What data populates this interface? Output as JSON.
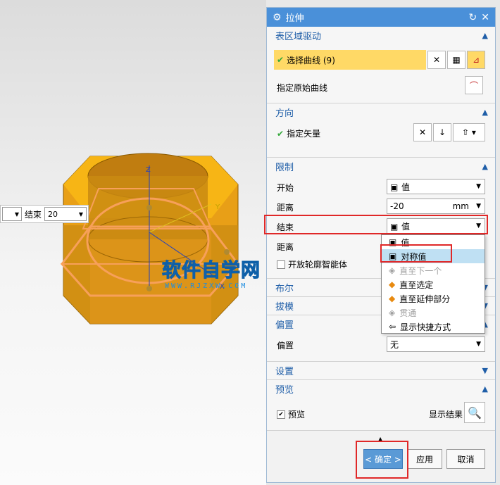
{
  "toolbar": {
    "end_label": "结束",
    "end_value": "20"
  },
  "watermark": {
    "main": "软件自学网",
    "sub": "WWW.RJZXW.COM"
  },
  "dialog": {
    "title": "拉伸",
    "sections": {
      "section_drive": {
        "header": "表区域驱动",
        "select_curve": "选择曲线 (9)",
        "specify_original": "指定原始曲线"
      },
      "section_direction": {
        "header": "方向",
        "specify_vector": "指定矢量"
      },
      "section_limits": {
        "header": "限制",
        "start_label": "开始",
        "start_value": "值",
        "distance_label": "距离",
        "distance_value": "-20",
        "distance_unit": "mm",
        "end_label": "结束",
        "end_value": "值",
        "distance2_label": "距离",
        "open_profile": "开放轮廓智能体"
      },
      "section_bool": {
        "header": "布尔"
      },
      "section_draft": {
        "header": "拔模"
      },
      "section_offset": {
        "header": "偏置",
        "offset_label": "偏置",
        "offset_value": "无"
      },
      "section_settings": {
        "header": "设置"
      },
      "section_preview": {
        "header": "预览",
        "preview_label": "预览",
        "show_result": "显示结果"
      }
    },
    "buttons": {
      "ok": "< 确定 >",
      "apply": "应用",
      "cancel": "取消"
    }
  },
  "dropdown_menu": {
    "items": [
      {
        "label": "值",
        "state": "normal"
      },
      {
        "label": "对称值",
        "state": "selected"
      },
      {
        "label": "直至下一个",
        "state": "disabled"
      },
      {
        "label": "直至选定",
        "state": "normal"
      },
      {
        "label": "直至延伸部分",
        "state": "normal"
      },
      {
        "label": "贯通",
        "state": "disabled"
      },
      {
        "label": "显示快捷方式",
        "state": "normal"
      }
    ]
  },
  "colors": {
    "accent": "#4a90d9",
    "header_text": "#1f5ea8",
    "highlight_row": "#ffd966",
    "nut": "#f0a81c",
    "preview": "#f7a05a",
    "annotation": "#e02828"
  },
  "icons": [
    "gear-icon",
    "reset-icon",
    "close-icon",
    "checkmark-icon",
    "curve-icon",
    "vector-icon",
    "cube-icon",
    "magnifier-icon",
    "chevron-up-icon",
    "chevron-down-icon"
  ]
}
